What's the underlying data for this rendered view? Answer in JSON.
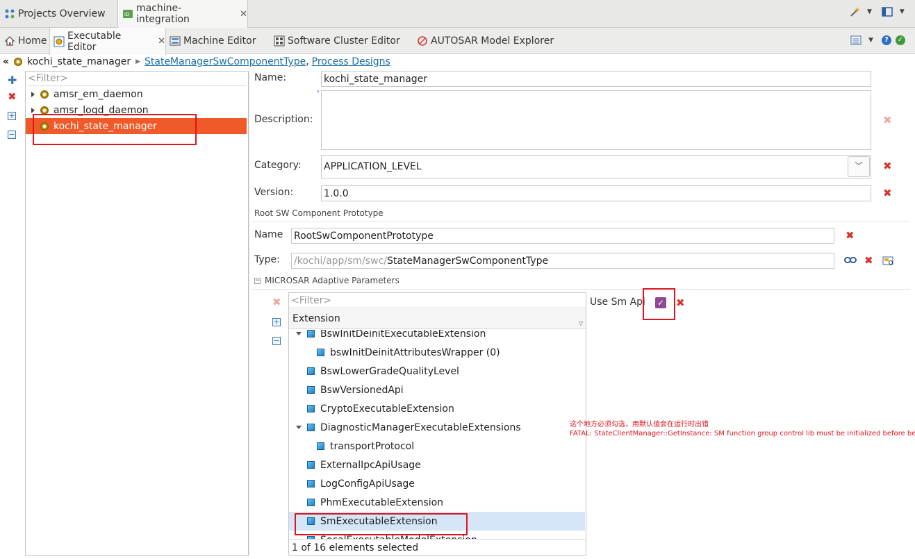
{
  "top_tabs": [
    {
      "label": "Projects Overview",
      "icon": "projects-overview-icon"
    },
    {
      "label": "machine-integration",
      "icon": "machine-integration-icon",
      "close": "✕"
    }
  ],
  "editor_tabs": [
    {
      "label": "Home",
      "icon": "home-icon"
    },
    {
      "label": "Executable Editor",
      "icon": "executable-editor-icon",
      "close": "✕"
    },
    {
      "label": "Machine Editor",
      "icon": "machine-editor-icon"
    },
    {
      "label": "Software Cluster Editor",
      "icon": "software-cluster-icon"
    },
    {
      "label": "AUTOSAR Model Explorer",
      "icon": "autosar-explorer-icon"
    }
  ],
  "breadcrumb": {
    "back": "«",
    "current": "kochi_state_manager",
    "link1": "StateManagerSwComponentType",
    "sep": ",",
    "link2": "Process Designs"
  },
  "tree": {
    "filter_placeholder": "<Filter>",
    "items": [
      "amsr_em_daemon",
      "amsr_logd_daemon",
      "kochi_state_manager"
    ],
    "selected_index": 2
  },
  "form": {
    "name_label": "Name:",
    "name_value": "kochi_state_manager",
    "description_label": "Description:",
    "description_value": "",
    "category_label": "Category:",
    "category_value": "APPLICATION_LEVEL",
    "version_label": "Version:",
    "version_value": "1.0.0",
    "root_section": "Root SW Component Prototype",
    "root_name_label": "Name",
    "root_name_value": "RootSwComponentPrototype",
    "type_label": "Type:",
    "type_prefix": "/kochi/app/sm/swc/",
    "type_value": "StateManagerSwComponentType",
    "microsar_section": "MICROSAR Adaptive Parameters",
    "collapse_glyph": "−"
  },
  "extensions": {
    "filter_placeholder": "<Filter>",
    "column_header": "Extension",
    "rows": [
      {
        "label": "BswInitDeinitExecutableExtension",
        "level": 0,
        "expanded": true
      },
      {
        "label": "bswInitDeinitAttributesWrapper (0)",
        "level": 1,
        "expanded": false
      },
      {
        "label": "BswLowerGradeQualityLevel",
        "level": 0,
        "expanded": false
      },
      {
        "label": "BswVersionedApi",
        "level": 0,
        "expanded": false
      },
      {
        "label": "CryptoExecutableExtension",
        "level": 0,
        "expanded": false
      },
      {
        "label": "DiagnosticManagerExecutableExtensions",
        "level": 0,
        "expanded": true
      },
      {
        "label": "transportProtocol",
        "level": 1,
        "expanded": false
      },
      {
        "label": "ExternalIpcApiUsage",
        "level": 0,
        "expanded": false
      },
      {
        "label": "LogConfigApiUsage",
        "level": 0,
        "expanded": false
      },
      {
        "label": "PhmExecutableExtension",
        "level": 0,
        "expanded": false
      },
      {
        "label": "SmExecutableExtension",
        "level": 0,
        "expanded": false
      },
      {
        "label": "SocalExecutableModelExtension",
        "level": 0,
        "expanded": false
      }
    ],
    "selected_index": 10,
    "status": "1 of 16 elements selected"
  },
  "use_sm_api": {
    "label": "Use Sm Api",
    "checked": true
  },
  "annotation": {
    "line1": "这个地方必须勾选，用默认值会在运行时出错",
    "line2": "FATAL: StateClientManager::GetInstance: SM function group control lib must be initialized before be"
  },
  "colors": {
    "selection_orange": "#f05a28",
    "selection_blue": "#d5e6f8",
    "annotation_red": "#e0141c",
    "checkbox_purple": "#8e4a93"
  }
}
